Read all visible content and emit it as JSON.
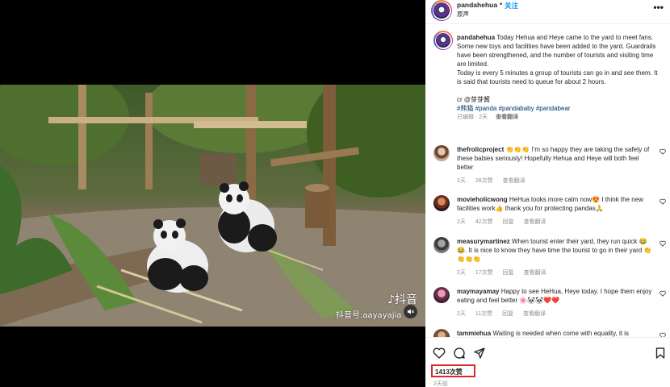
{
  "video": {
    "watermark_logo": "♪抖音",
    "watermark_id": "抖音号:aayayajia"
  },
  "header": {
    "username": "pandahehua",
    "dot": "•",
    "follow_label": "关注",
    "subtitle": "原声",
    "more": "•••"
  },
  "caption": {
    "username": "pandahehua",
    "lines": [
      "Today Hehua and Heye came to the yard to meet fans.",
      "Some new toys and facilities have been added to the yard. Guardrails have been strengthened, and the number of tourists and visiting time are limited.",
      "Today is every 5 minutes a group of tourists can go in and see them. It is said that tourists need to queue for about 2 hours.",
      "",
      "cr @芽芽酱"
    ],
    "hashtags": "#熊猫 #panda #pandababy #pandabear",
    "edited": "已编辑 · 2天",
    "translate": "查看翻译"
  },
  "comments": [
    {
      "username": "thefrolicproject",
      "text": "👏👏👏 I'm so happy they are taking the safety of these babies seriously! Hopefully Hehua and Heye will both feel better",
      "time": "2天",
      "likes": "28次赞",
      "translate": "查看翻译"
    },
    {
      "username": "movieholicwong",
      "text": "HeHua looks more calm now😍 I think the new facilities work👍 thank you for protecting pandas🙏",
      "time": "2天",
      "likes": "42次赞",
      "reply": "回复",
      "translate": "查看翻译"
    },
    {
      "username": "measurymartinez",
      "text": "When tourist enter their yard, they run quick 😂😂. It is nice to know they have time the tourist to go in their yard 👏👏👏👏",
      "time": "2天",
      "likes": "17次赞",
      "reply": "回复",
      "translate": "查看翻译"
    },
    {
      "username": "maymayamay",
      "text": "Happy to see HeHua, Heye today. I hope them enjoy eating and feel better 🌸🐼🐼❤️❤️",
      "time": "2天",
      "likes": "11次赞",
      "reply": "回复",
      "translate": "查看翻译"
    },
    {
      "username": "tammiehua",
      "text": "Waiting is needed when come with equality, it is"
    }
  ],
  "actions": {
    "likes": "1413次赞",
    "time_ago": "2天前"
  },
  "colors": {
    "follow_blue": "#0095f6",
    "hashtag_blue": "#00376b",
    "highlight_red": "#e0262a",
    "meta_gray": "#8e8e8e"
  }
}
